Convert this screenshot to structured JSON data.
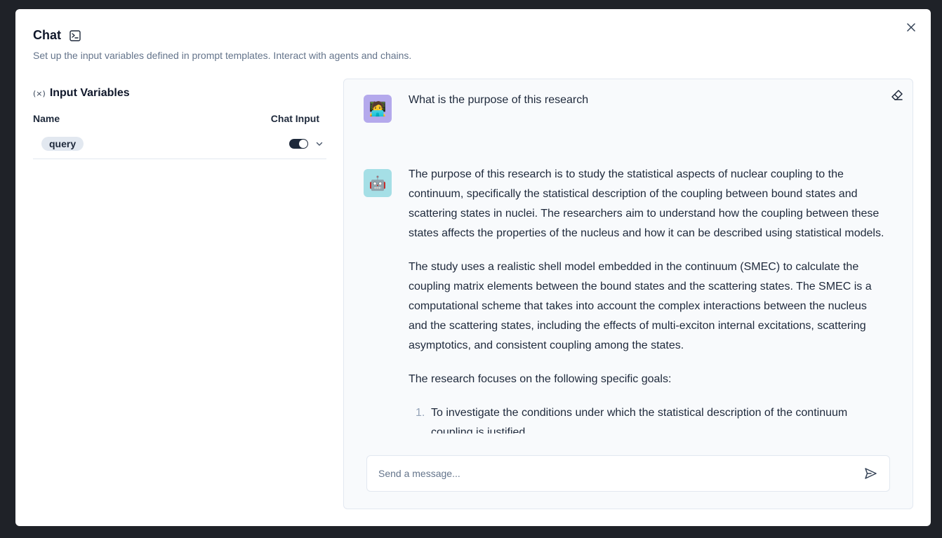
{
  "modal": {
    "title": "Chat",
    "subtitle": "Set up the input variables defined in prompt templates. Interact with agents and chains."
  },
  "input_variables": {
    "title": "Input Variables",
    "icon_glyph": "(×)",
    "col_name": "Name",
    "col_chat_input": "Chat Input",
    "rows": [
      {
        "name": "query",
        "chat_input_enabled": true
      }
    ]
  },
  "chat": {
    "messages": [
      {
        "role": "user",
        "avatar": "🧑‍💻",
        "text": "What is the purpose of this research"
      },
      {
        "role": "bot",
        "avatar": "🤖",
        "paragraphs": [
          "The purpose of this research is to study the statistical aspects of nuclear coupling to the continuum, specifically the statistical description of the coupling between bound states and scattering states in nuclei. The researchers aim to understand how the coupling between these states affects the properties of the nucleus and how it can be described using statistical models.",
          "The study uses a realistic shell model embedded in the continuum (SMEC) to calculate the coupling matrix elements between the bound states and the scattering states. The SMEC is a computational scheme that takes into account the complex interactions between the nucleus and the scattering states, including the effects of multi-exciton internal excitations, scattering asymptotics, and consistent coupling among the states.",
          "The research focuses on the following specific goals:"
        ],
        "list": [
          {
            "num": "1.",
            "text": "To investigate the conditions under which the statistical description of the continuum coupling is justified."
          }
        ]
      }
    ],
    "input_placeholder": "Send a message..."
  },
  "colors": {
    "user_avatar_bg": "#b4a9ec",
    "bot_avatar_bg": "#a5dfe6",
    "toggle_on": "#1e293b"
  }
}
